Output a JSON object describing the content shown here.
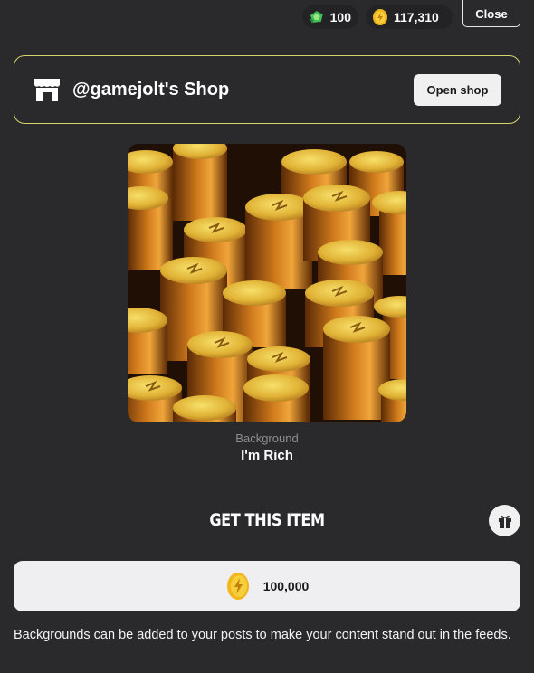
{
  "header": {
    "gems_count": "100",
    "coins_count": "117,310",
    "close_label": "Close"
  },
  "shop": {
    "title": "@gamejolt's Shop",
    "open_label": "Open shop"
  },
  "item": {
    "type": "Background",
    "name": "I'm Rich"
  },
  "purchase": {
    "section_title": "GET THIS ITEM",
    "price": "100,000"
  },
  "description": "Backgrounds can be added to your posts to make your content stand out in the feeds.",
  "icons": {
    "gems": "gem-icon",
    "coins": "coin-icon",
    "store": "store-icon",
    "gift": "gift-icon"
  },
  "colors": {
    "background": "#2a2a2c",
    "shop_border": "#d6d36a",
    "coin_gold": "#f2b51c",
    "gem_green": "#3fbf5a"
  }
}
